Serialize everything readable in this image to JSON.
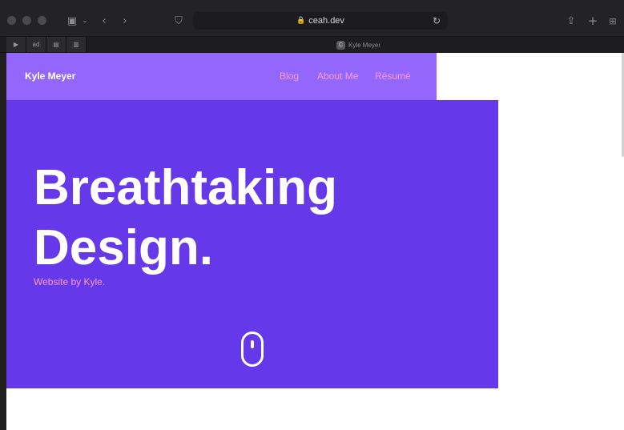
{
  "browser": {
    "url": "ceah.dev",
    "tab_title": "Kyle Meyer",
    "favicon_letter": "C",
    "pinned_tabs": [
      "▶",
      "ad",
      "▤",
      "▥"
    ],
    "icons": {
      "sidebar": "sidebar-icon",
      "back": "chevron-left-icon",
      "forward": "chevron-right-icon",
      "privacy": "shield-icon",
      "reload": "reload-icon",
      "share": "share-icon",
      "new_tab": "plus-icon",
      "tab_overview": "grid-icon"
    }
  },
  "site": {
    "brand": "Kyle Meyer",
    "nav": {
      "blog": "Blog",
      "about": "About Me",
      "resume": "Résumé"
    },
    "hero": {
      "line1": "Breathtaking",
      "line2": "Design.",
      "subtitle": "Website by Kyle."
    },
    "scroll_icon": "mouse-scroll-icon"
  },
  "colors": {
    "nav_bg": "#9367fb",
    "hero_bg": "#6539e9",
    "accent_pink": "#ff9be1",
    "white": "#ffffff"
  }
}
